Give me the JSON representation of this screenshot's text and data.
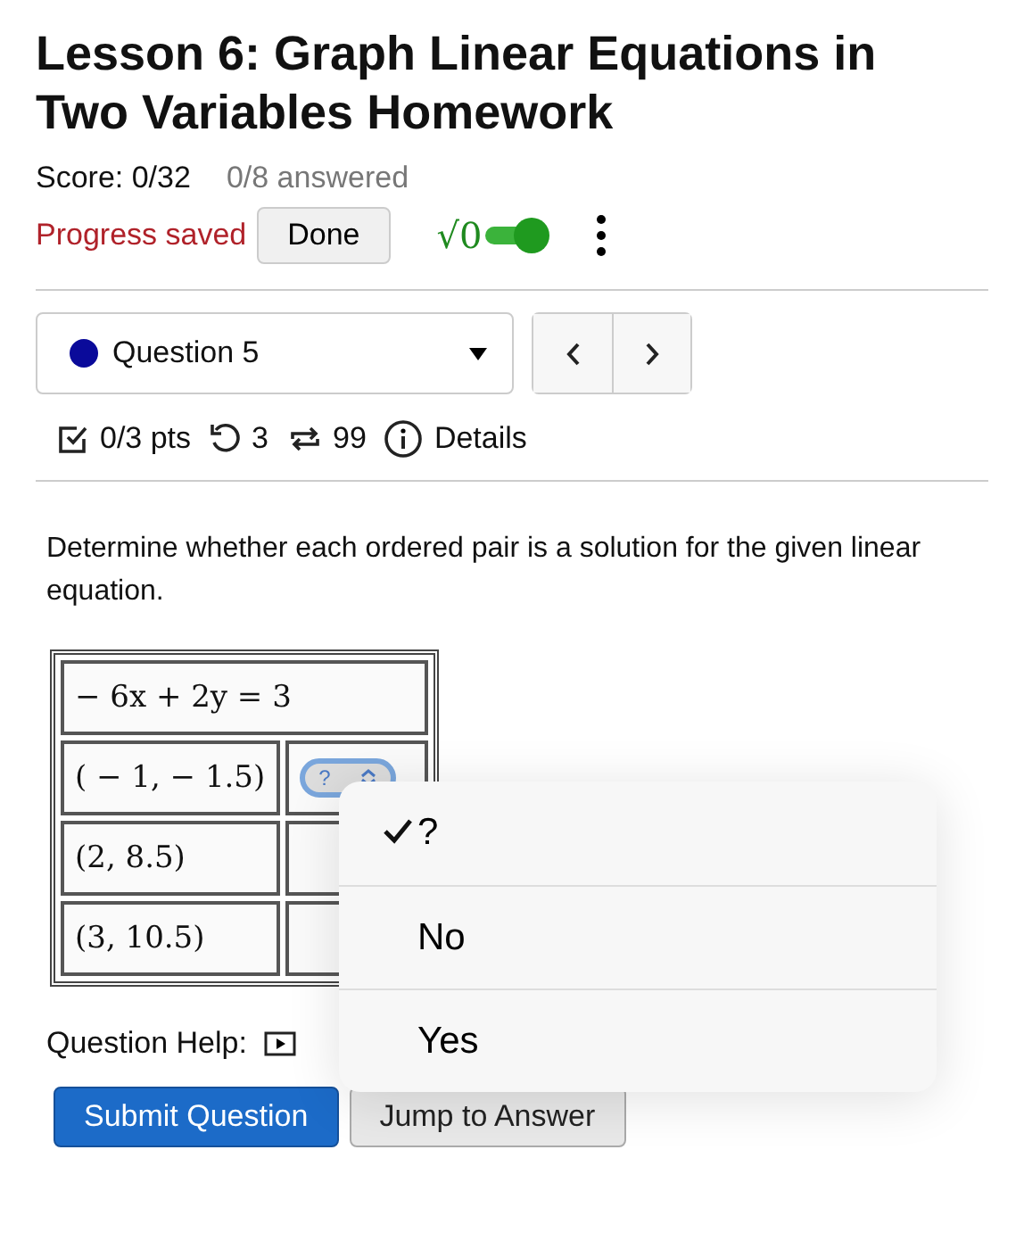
{
  "title": "Lesson 6: Graph Linear Equations in Two Variables Homework",
  "score": "Score: 0/32",
  "answered": "0/8 answered",
  "progress": "Progress saved",
  "done_button": "Done",
  "math_toggle": {
    "label": "√0",
    "on": true
  },
  "question_select": {
    "label": "Question 5",
    "color": "#0a0a9a"
  },
  "stats": {
    "points": "0/3 pts",
    "retries": "3",
    "attempts": "99",
    "details": "Details"
  },
  "instruction": "Determine whether each ordered pair is a solution for the given linear equation.",
  "table": {
    "equation": "− 6x + 2y = 3",
    "rows": [
      {
        "pair": "( − 1, − 1.5)",
        "answer": "?"
      },
      {
        "pair": "(2, 8.5)"
      },
      {
        "pair": "(3, 10.5)"
      }
    ]
  },
  "help_label": "Question Help:",
  "buttons": {
    "submit": "Submit Question",
    "jump": "Jump to Answer"
  },
  "menu": {
    "options": [
      {
        "label": "?",
        "selected": true
      },
      {
        "label": "No",
        "selected": false
      },
      {
        "label": "Yes",
        "selected": false
      }
    ]
  }
}
